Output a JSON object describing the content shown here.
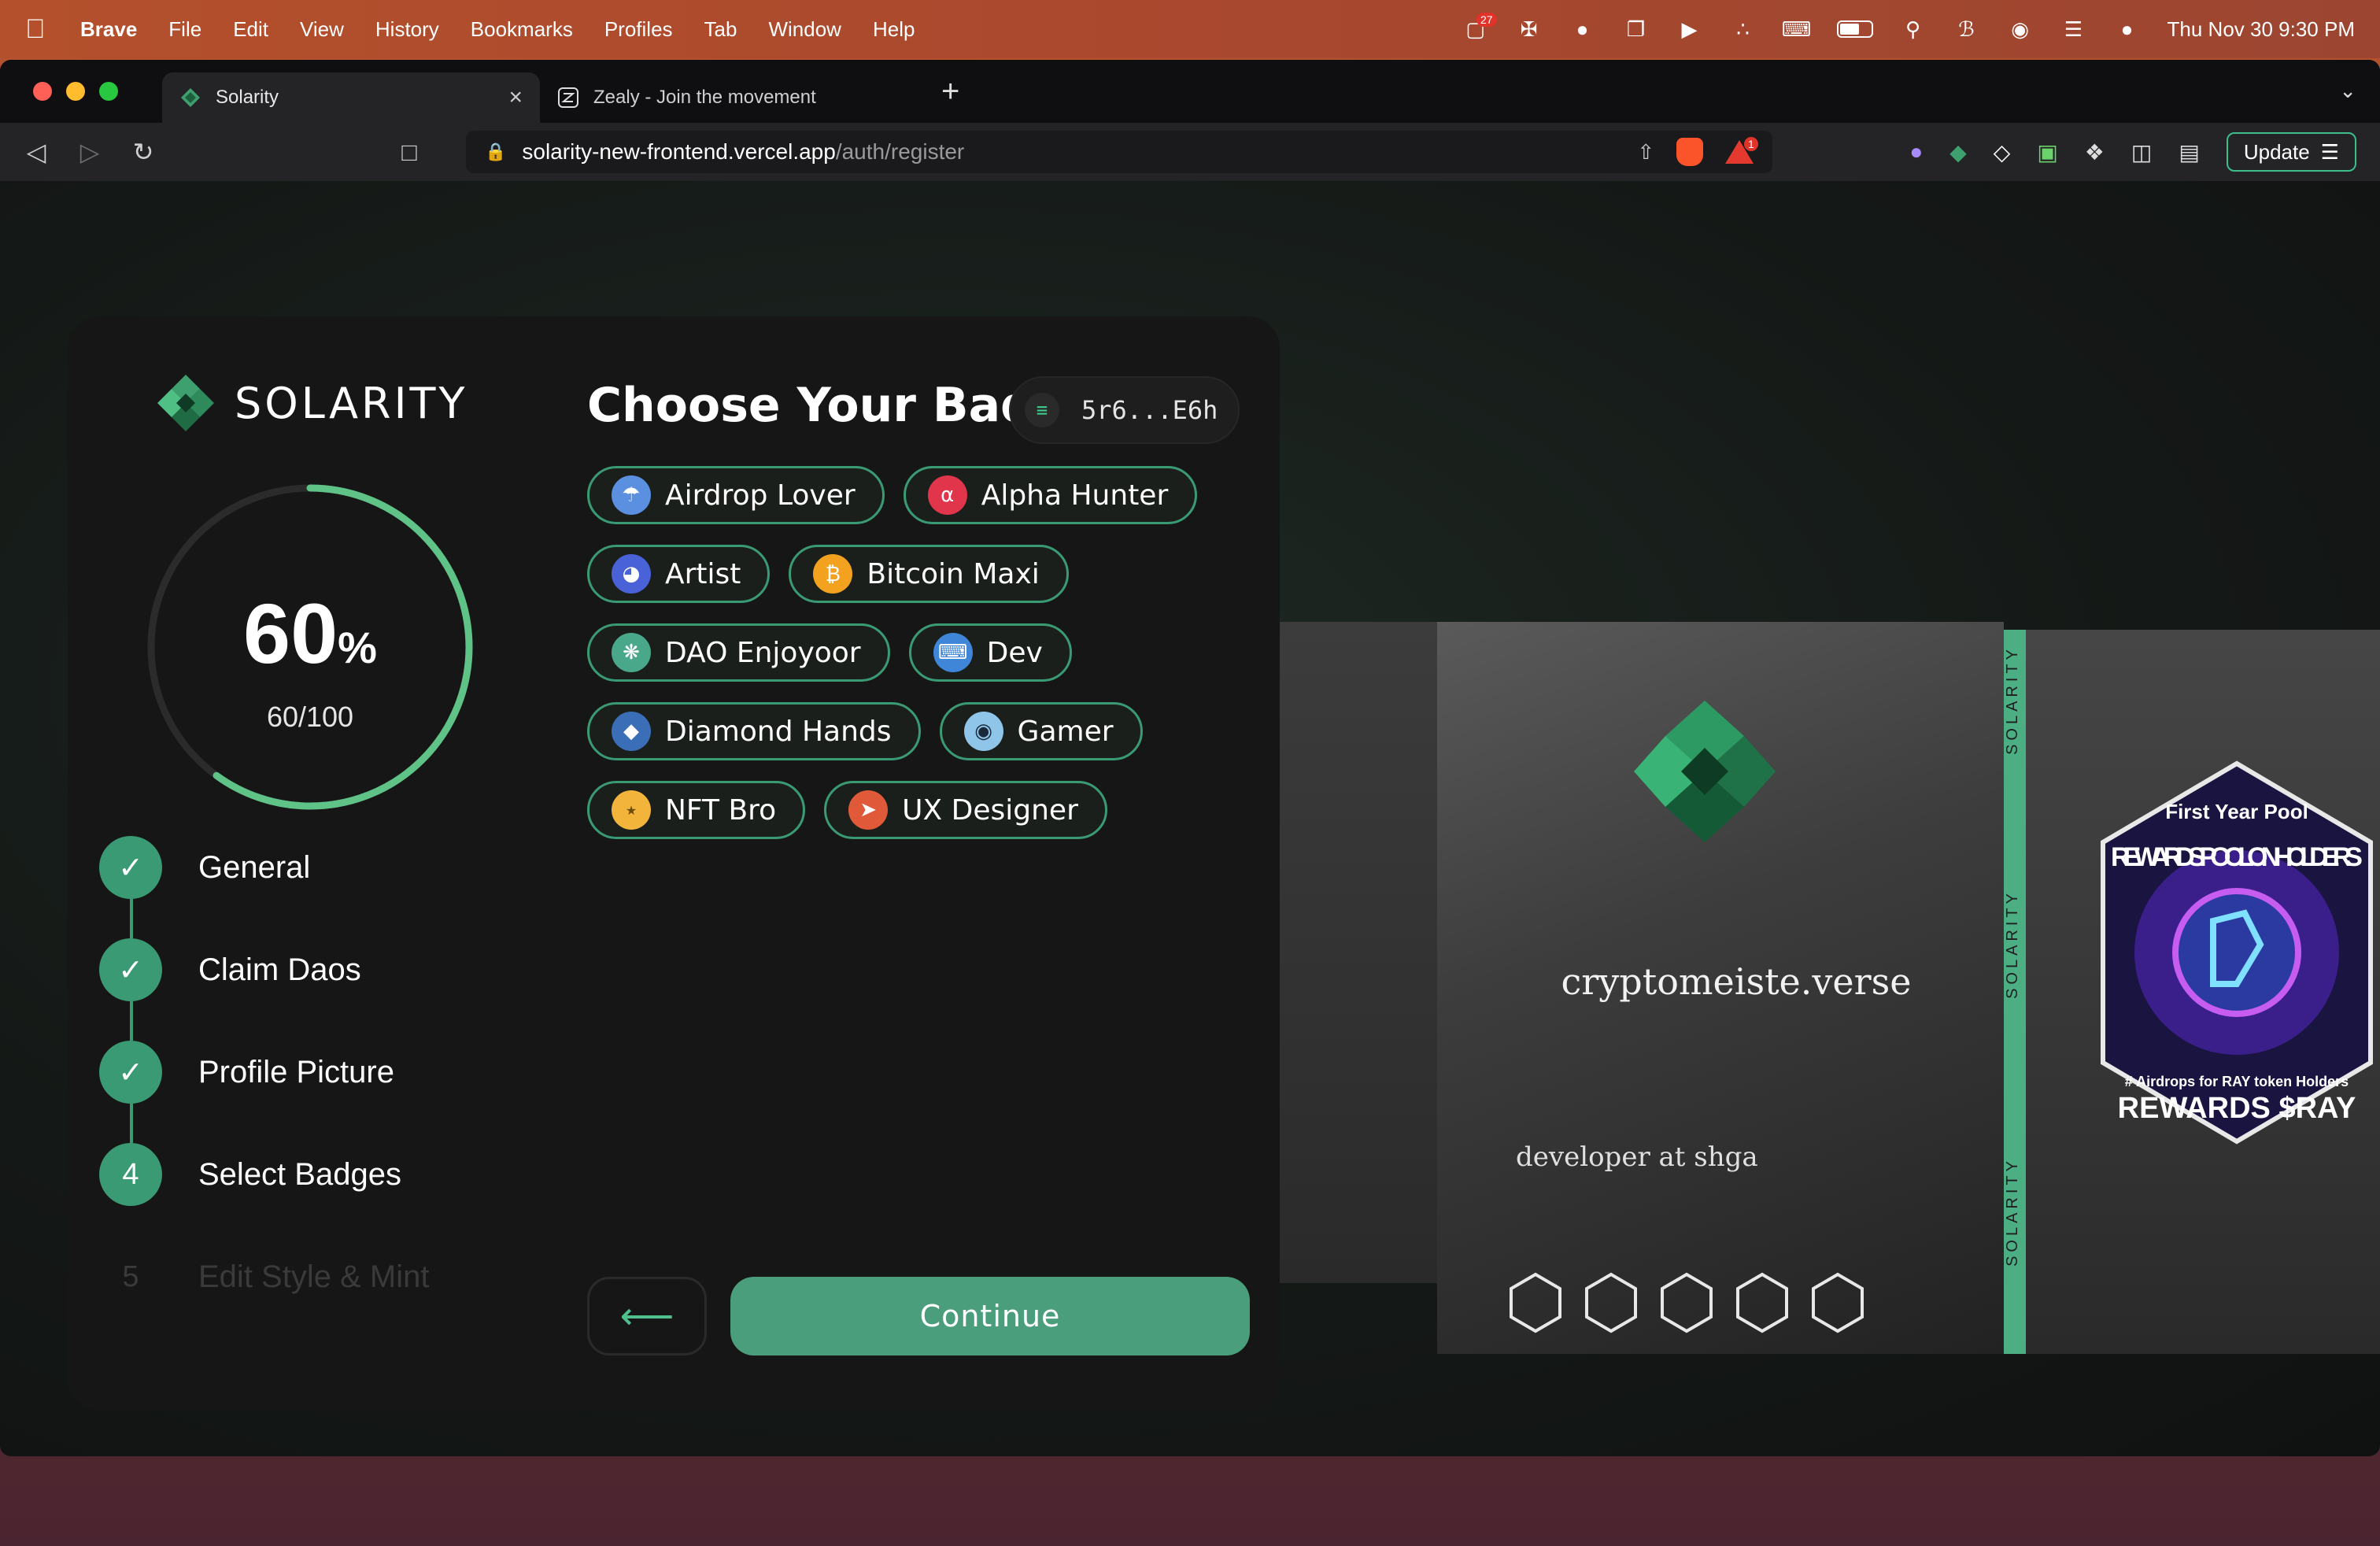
{
  "menubar": {
    "app_name": "Brave",
    "items": [
      "File",
      "Edit",
      "View",
      "History",
      "Bookmarks",
      "Profiles",
      "Tab",
      "Window",
      "Help"
    ],
    "badge_count": "27",
    "clock": "Thu Nov 30  9:30 PM"
  },
  "tabs": [
    {
      "label": "Solarity",
      "active": true
    },
    {
      "label": "Zealy - Join the movement",
      "active": false
    }
  ],
  "address_bar": {
    "host": "solarity-new-frontend.vercel.app",
    "path": "/auth/register",
    "shields_notifications": "1"
  },
  "toolbar": {
    "update_label": "Update"
  },
  "sidebar": {
    "logo_text": "SOLARITY",
    "progress_percent": "60",
    "percent_sign": "%",
    "progress_value": 60,
    "progress_count": "60/100",
    "steps": [
      {
        "number": "1",
        "label": "General",
        "status": "done"
      },
      {
        "number": "2",
        "label": "Claim Daos",
        "status": "done"
      },
      {
        "number": "3",
        "label": "Profile Picture",
        "status": "done"
      },
      {
        "number": "4",
        "label": "Select Badges",
        "status": "current"
      },
      {
        "number": "5",
        "label": "Edit Style & Mint",
        "status": "pending"
      }
    ]
  },
  "main": {
    "heading": "Choose Your Badge",
    "wallet_address": "5r6...E6h",
    "badges": [
      {
        "label": "Airdrop Lover",
        "icon": "parachute-icon",
        "color": "#5b8fe0"
      },
      {
        "label": "Alpha Hunter",
        "icon": "alpha-icon",
        "color": "#e0354b"
      },
      {
        "label": "Artist",
        "icon": "palette-icon",
        "color": "#4a62d8"
      },
      {
        "label": "Bitcoin Maxi",
        "icon": "bitcoin-icon",
        "color": "#f2a21f"
      },
      {
        "label": "DAO Enjoyoor",
        "icon": "dao-icon",
        "color": "#4aa88a"
      },
      {
        "label": "Dev",
        "icon": "code-icon",
        "color": "#3f86d8"
      },
      {
        "label": "Diamond Hands",
        "icon": "diamond-icon",
        "color": "#3a6fb8"
      },
      {
        "label": "Gamer",
        "icon": "gamepad-icon",
        "color": "#8ec5e8"
      },
      {
        "label": "NFT Bro",
        "icon": "nft-icon",
        "color": "#f2b43a"
      },
      {
        "label": "UX Designer",
        "icon": "rocket-icon",
        "color": "#e05a3a"
      }
    ],
    "continue_label": "Continue"
  },
  "preview": {
    "username": "cryptomeiste.verse",
    "role": "developer at shga",
    "strip_text": "SOLARITY",
    "reward": {
      "top_text": "First Year Pool",
      "arc_text": "REWARDS POOL ON HOLDERS",
      "sub_text": "# Airdrops for RAY token Holders",
      "title": "REWARDS $RAY"
    }
  },
  "colors": {
    "accent": "#4a9e7c",
    "ring": "#5fc286",
    "card_bg": "#161616"
  }
}
